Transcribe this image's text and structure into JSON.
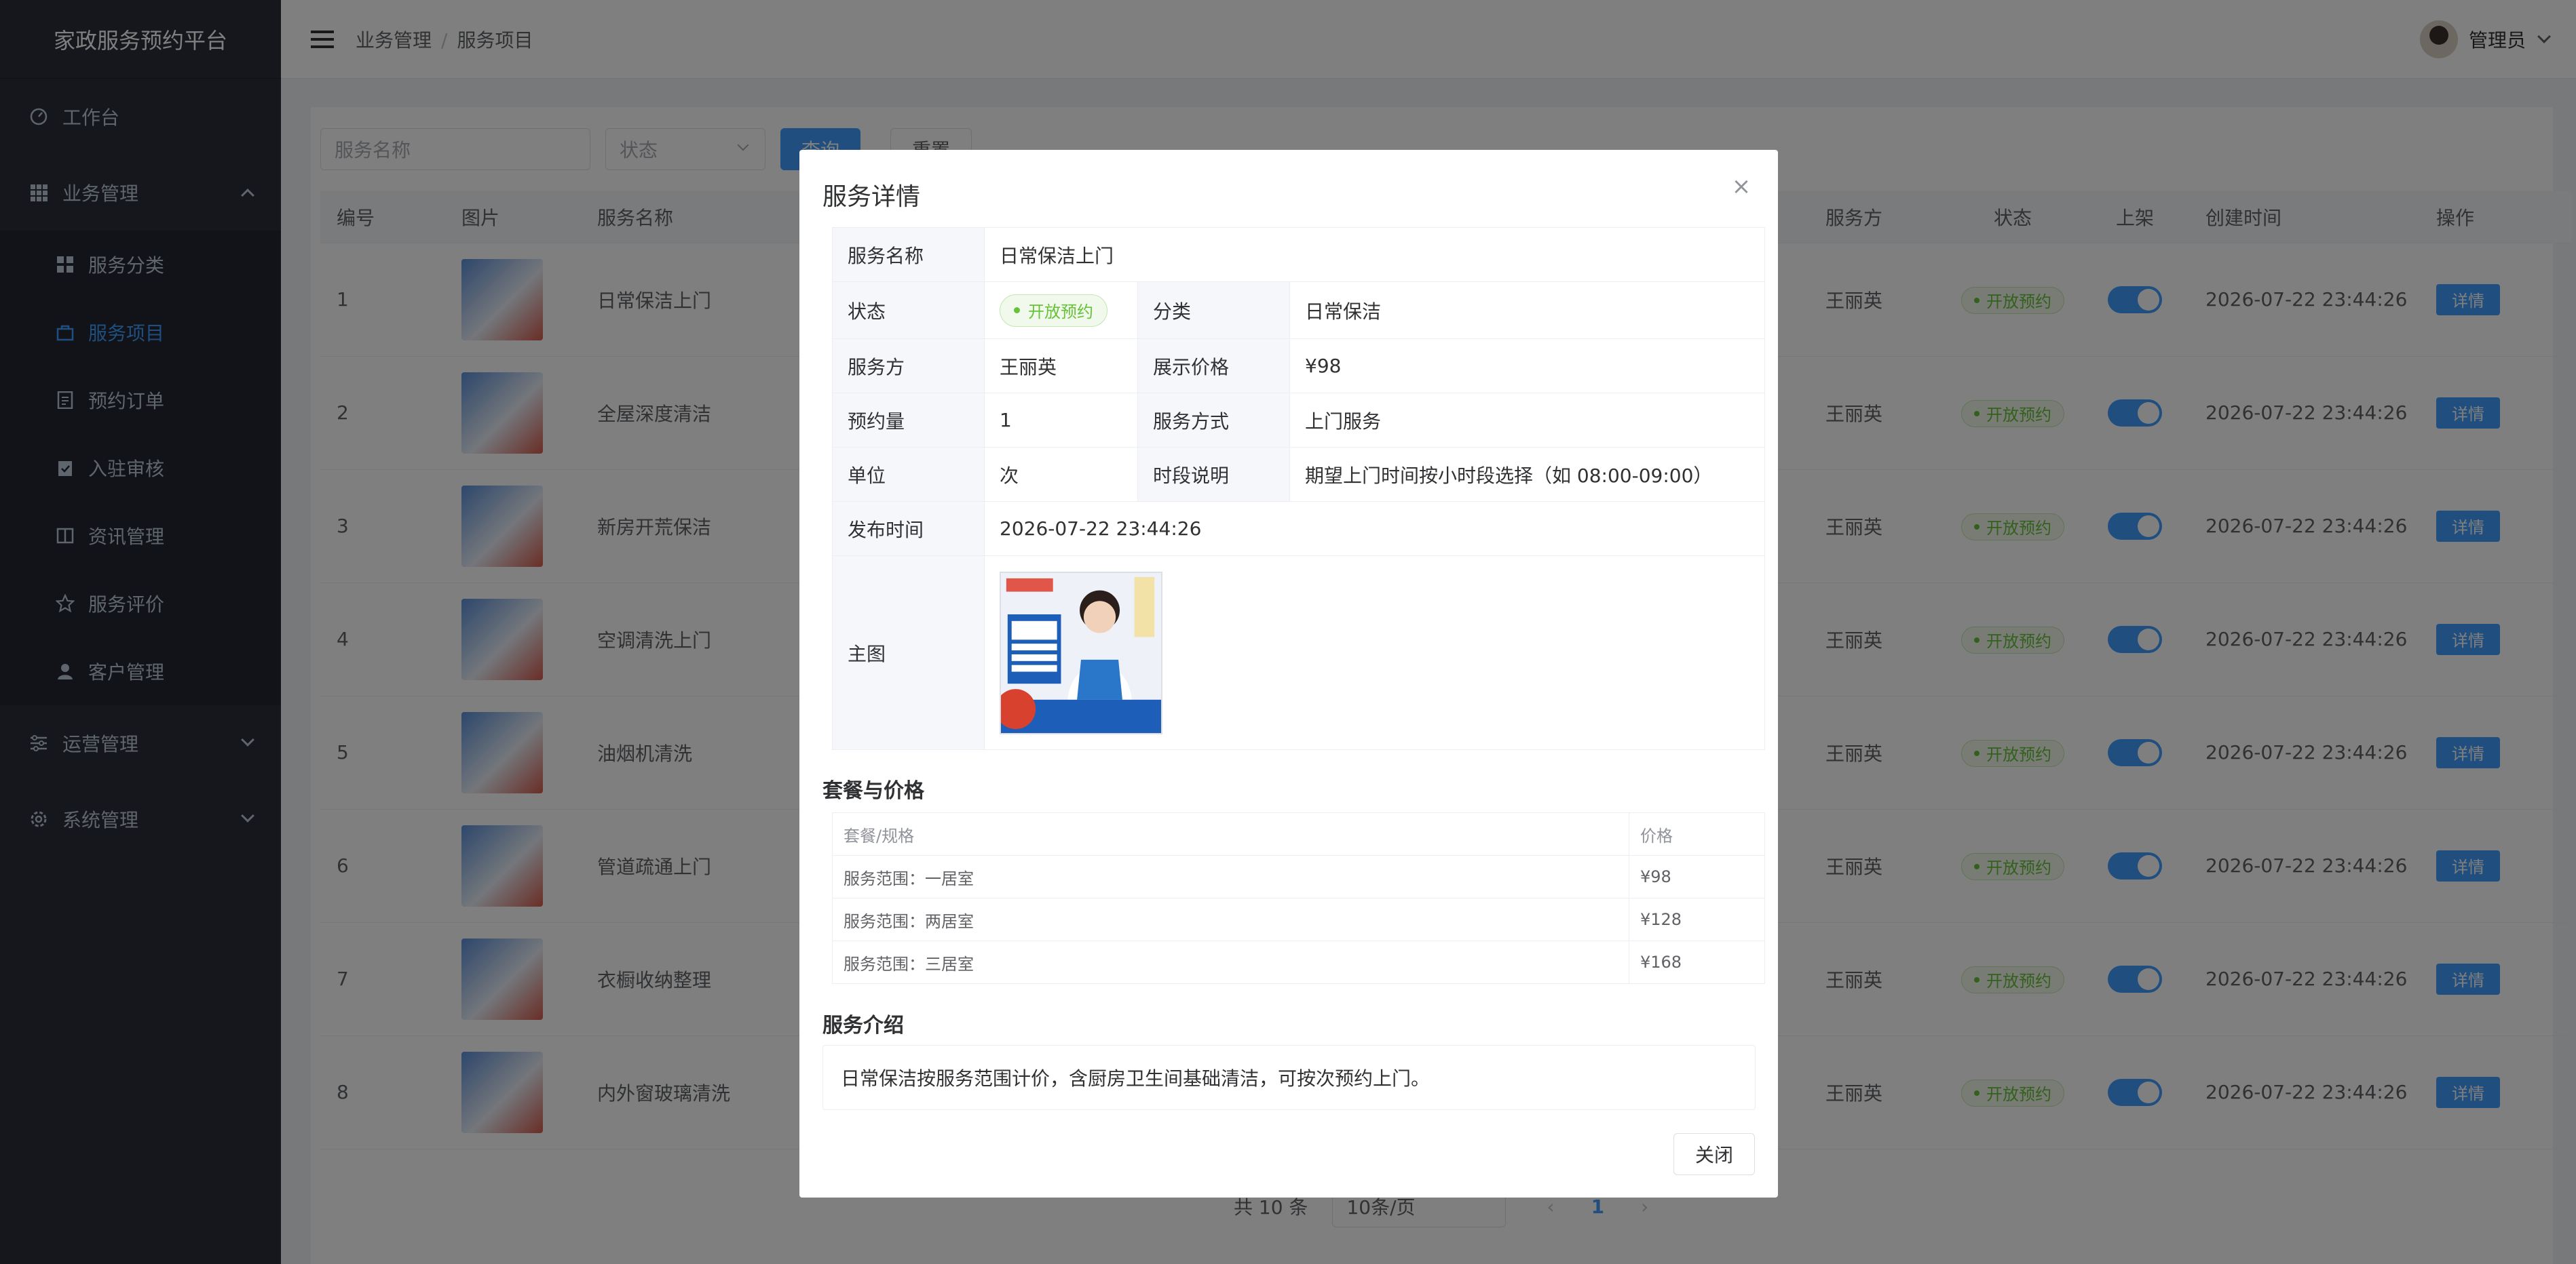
{
  "app_title": "家政服务预约平台",
  "sidebar": {
    "workbench": "工作台",
    "business": "业务管理",
    "sub_items": [
      {
        "label": "服务分类",
        "icon": "grid-icon"
      },
      {
        "label": "服务项目",
        "icon": "bag-icon"
      },
      {
        "label": "预约订单",
        "icon": "document-icon"
      },
      {
        "label": "入驻审核",
        "icon": "clipboard-check-icon"
      },
      {
        "label": "资讯管理",
        "icon": "book-icon"
      },
      {
        "label": "服务评价",
        "icon": "star-icon"
      },
      {
        "label": "客户管理",
        "icon": "user-icon"
      }
    ],
    "operations": "运营管理",
    "system": "系统管理"
  },
  "header": {
    "breadcrumb": [
      "业务管理",
      "服务项目"
    ],
    "username": "管理员"
  },
  "filters": {
    "name_placeholder": "服务名称",
    "status_placeholder": "状态",
    "query_label": "查询",
    "reset_label": "重置"
  },
  "table": {
    "columns": [
      "编号",
      "图片",
      "服务名称",
      "服务方",
      "状态",
      "上架",
      "创建时间",
      "操作"
    ],
    "rows": [
      {
        "id": "1",
        "name": "日常保洁上门",
        "provider": "王丽英",
        "status": "开放预约",
        "created": "2026-07-22 23:44:26",
        "action": "详情"
      },
      {
        "id": "2",
        "name": "全屋深度清洁",
        "provider": "王丽英",
        "status": "开放预约",
        "created": "2026-07-22 23:44:26",
        "action": "详情"
      },
      {
        "id": "3",
        "name": "新房开荒保洁",
        "provider": "王丽英",
        "status": "开放预约",
        "created": "2026-07-22 23:44:26",
        "action": "详情"
      },
      {
        "id": "4",
        "name": "空调清洗上门",
        "provider": "王丽英",
        "status": "开放预约",
        "created": "2026-07-22 23:44:26",
        "action": "详情"
      },
      {
        "id": "5",
        "name": "油烟机清洗",
        "provider": "王丽英",
        "status": "开放预约",
        "created": "2026-07-22 23:44:26",
        "action": "详情"
      },
      {
        "id": "6",
        "name": "管道疏通上门",
        "provider": "王丽英",
        "status": "开放预约",
        "created": "2026-07-22 23:44:26",
        "action": "详情"
      },
      {
        "id": "7",
        "name": "衣橱收纳整理",
        "provider": "王丽英",
        "status": "开放预约",
        "created": "2026-07-22 23:44:26",
        "action": "详情"
      },
      {
        "id": "8",
        "name": "内外窗玻璃清洗",
        "provider": "王丽英",
        "status": "开放预约",
        "created": "2026-07-22 23:44:26",
        "action": "详情"
      }
    ]
  },
  "pagination": {
    "total": "共 10 条",
    "page_size": "10条/页",
    "current": "1"
  },
  "dialog": {
    "title": "服务详情",
    "fields": {
      "name_label": "服务名称",
      "name": "日常保洁上门",
      "status_label": "状态",
      "status": "开放预约",
      "category_label": "分类",
      "category": "日常保洁",
      "provider_label": "服务方",
      "provider": "王丽英",
      "price_label": "展示价格",
      "price": "¥98",
      "bookings_label": "预约量",
      "bookings": "1",
      "mode_label": "服务方式",
      "mode": "上门服务",
      "unit_label": "单位",
      "unit": "次",
      "slot_label": "时段说明",
      "slot": "期望上门时间按小时段选择（如 08:00-09:00）",
      "published_label": "发布时间",
      "published": "2026-07-22 23:44:26",
      "image_label": "主图"
    },
    "packages_title": "套餐与价格",
    "packages_columns": [
      "套餐/规格",
      "价格"
    ],
    "packages": [
      {
        "spec": "服务范围：一居室",
        "price": "¥98"
      },
      {
        "spec": "服务范围：两居室",
        "price": "¥128"
      },
      {
        "spec": "服务范围：三居室",
        "price": "¥168"
      }
    ],
    "intro_title": "服务介绍",
    "intro": "日常保洁按服务范围计价，含厨房卫生间基础清洁，可按次预约上门。",
    "close_label": "关闭"
  }
}
